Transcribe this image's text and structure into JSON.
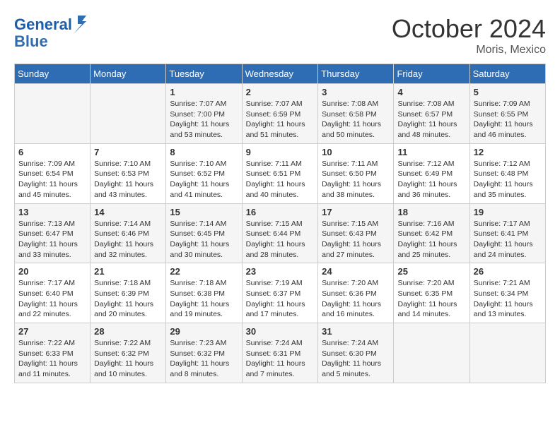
{
  "header": {
    "logo_line1": "General",
    "logo_line2": "Blue",
    "month": "October 2024",
    "location": "Moris, Mexico"
  },
  "days_of_week": [
    "Sunday",
    "Monday",
    "Tuesday",
    "Wednesday",
    "Thursday",
    "Friday",
    "Saturday"
  ],
  "weeks": [
    [
      {
        "day": "",
        "sunrise": "",
        "sunset": "",
        "daylight": ""
      },
      {
        "day": "",
        "sunrise": "",
        "sunset": "",
        "daylight": ""
      },
      {
        "day": "1",
        "sunrise": "Sunrise: 7:07 AM",
        "sunset": "Sunset: 7:00 PM",
        "daylight": "Daylight: 11 hours and 53 minutes."
      },
      {
        "day": "2",
        "sunrise": "Sunrise: 7:07 AM",
        "sunset": "Sunset: 6:59 PM",
        "daylight": "Daylight: 11 hours and 51 minutes."
      },
      {
        "day": "3",
        "sunrise": "Sunrise: 7:08 AM",
        "sunset": "Sunset: 6:58 PM",
        "daylight": "Daylight: 11 hours and 50 minutes."
      },
      {
        "day": "4",
        "sunrise": "Sunrise: 7:08 AM",
        "sunset": "Sunset: 6:57 PM",
        "daylight": "Daylight: 11 hours and 48 minutes."
      },
      {
        "day": "5",
        "sunrise": "Sunrise: 7:09 AM",
        "sunset": "Sunset: 6:55 PM",
        "daylight": "Daylight: 11 hours and 46 minutes."
      }
    ],
    [
      {
        "day": "6",
        "sunrise": "Sunrise: 7:09 AM",
        "sunset": "Sunset: 6:54 PM",
        "daylight": "Daylight: 11 hours and 45 minutes."
      },
      {
        "day": "7",
        "sunrise": "Sunrise: 7:10 AM",
        "sunset": "Sunset: 6:53 PM",
        "daylight": "Daylight: 11 hours and 43 minutes."
      },
      {
        "day": "8",
        "sunrise": "Sunrise: 7:10 AM",
        "sunset": "Sunset: 6:52 PM",
        "daylight": "Daylight: 11 hours and 41 minutes."
      },
      {
        "day": "9",
        "sunrise": "Sunrise: 7:11 AM",
        "sunset": "Sunset: 6:51 PM",
        "daylight": "Daylight: 11 hours and 40 minutes."
      },
      {
        "day": "10",
        "sunrise": "Sunrise: 7:11 AM",
        "sunset": "Sunset: 6:50 PM",
        "daylight": "Daylight: 11 hours and 38 minutes."
      },
      {
        "day": "11",
        "sunrise": "Sunrise: 7:12 AM",
        "sunset": "Sunset: 6:49 PM",
        "daylight": "Daylight: 11 hours and 36 minutes."
      },
      {
        "day": "12",
        "sunrise": "Sunrise: 7:12 AM",
        "sunset": "Sunset: 6:48 PM",
        "daylight": "Daylight: 11 hours and 35 minutes."
      }
    ],
    [
      {
        "day": "13",
        "sunrise": "Sunrise: 7:13 AM",
        "sunset": "Sunset: 6:47 PM",
        "daylight": "Daylight: 11 hours and 33 minutes."
      },
      {
        "day": "14",
        "sunrise": "Sunrise: 7:14 AM",
        "sunset": "Sunset: 6:46 PM",
        "daylight": "Daylight: 11 hours and 32 minutes."
      },
      {
        "day": "15",
        "sunrise": "Sunrise: 7:14 AM",
        "sunset": "Sunset: 6:45 PM",
        "daylight": "Daylight: 11 hours and 30 minutes."
      },
      {
        "day": "16",
        "sunrise": "Sunrise: 7:15 AM",
        "sunset": "Sunset: 6:44 PM",
        "daylight": "Daylight: 11 hours and 28 minutes."
      },
      {
        "day": "17",
        "sunrise": "Sunrise: 7:15 AM",
        "sunset": "Sunset: 6:43 PM",
        "daylight": "Daylight: 11 hours and 27 minutes."
      },
      {
        "day": "18",
        "sunrise": "Sunrise: 7:16 AM",
        "sunset": "Sunset: 6:42 PM",
        "daylight": "Daylight: 11 hours and 25 minutes."
      },
      {
        "day": "19",
        "sunrise": "Sunrise: 7:17 AM",
        "sunset": "Sunset: 6:41 PM",
        "daylight": "Daylight: 11 hours and 24 minutes."
      }
    ],
    [
      {
        "day": "20",
        "sunrise": "Sunrise: 7:17 AM",
        "sunset": "Sunset: 6:40 PM",
        "daylight": "Daylight: 11 hours and 22 minutes."
      },
      {
        "day": "21",
        "sunrise": "Sunrise: 7:18 AM",
        "sunset": "Sunset: 6:39 PM",
        "daylight": "Daylight: 11 hours and 20 minutes."
      },
      {
        "day": "22",
        "sunrise": "Sunrise: 7:18 AM",
        "sunset": "Sunset: 6:38 PM",
        "daylight": "Daylight: 11 hours and 19 minutes."
      },
      {
        "day": "23",
        "sunrise": "Sunrise: 7:19 AM",
        "sunset": "Sunset: 6:37 PM",
        "daylight": "Daylight: 11 hours and 17 minutes."
      },
      {
        "day": "24",
        "sunrise": "Sunrise: 7:20 AM",
        "sunset": "Sunset: 6:36 PM",
        "daylight": "Daylight: 11 hours and 16 minutes."
      },
      {
        "day": "25",
        "sunrise": "Sunrise: 7:20 AM",
        "sunset": "Sunset: 6:35 PM",
        "daylight": "Daylight: 11 hours and 14 minutes."
      },
      {
        "day": "26",
        "sunrise": "Sunrise: 7:21 AM",
        "sunset": "Sunset: 6:34 PM",
        "daylight": "Daylight: 11 hours and 13 minutes."
      }
    ],
    [
      {
        "day": "27",
        "sunrise": "Sunrise: 7:22 AM",
        "sunset": "Sunset: 6:33 PM",
        "daylight": "Daylight: 11 hours and 11 minutes."
      },
      {
        "day": "28",
        "sunrise": "Sunrise: 7:22 AM",
        "sunset": "Sunset: 6:32 PM",
        "daylight": "Daylight: 11 hours and 10 minutes."
      },
      {
        "day": "29",
        "sunrise": "Sunrise: 7:23 AM",
        "sunset": "Sunset: 6:32 PM",
        "daylight": "Daylight: 11 hours and 8 minutes."
      },
      {
        "day": "30",
        "sunrise": "Sunrise: 7:24 AM",
        "sunset": "Sunset: 6:31 PM",
        "daylight": "Daylight: 11 hours and 7 minutes."
      },
      {
        "day": "31",
        "sunrise": "Sunrise: 7:24 AM",
        "sunset": "Sunset: 6:30 PM",
        "daylight": "Daylight: 11 hours and 5 minutes."
      },
      {
        "day": "",
        "sunrise": "",
        "sunset": "",
        "daylight": ""
      },
      {
        "day": "",
        "sunrise": "",
        "sunset": "",
        "daylight": ""
      }
    ]
  ]
}
